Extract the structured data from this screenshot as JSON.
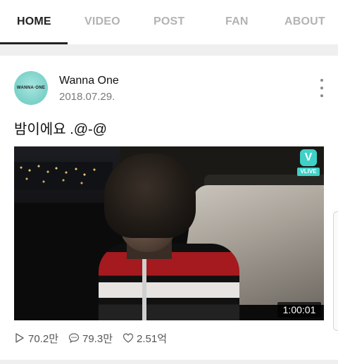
{
  "tabs": [
    {
      "label": "HOME",
      "active": true
    },
    {
      "label": "VIDEO",
      "active": false
    },
    {
      "label": "POST",
      "active": false
    },
    {
      "label": "FAN",
      "active": false
    },
    {
      "label": "ABOUT",
      "active": false
    }
  ],
  "post": {
    "avatar_text": "WANNA·ONE",
    "author": "Wanna One",
    "date": "2018.07.29.",
    "text": "밤이에요 .@-@",
    "video": {
      "badge_icon": "V",
      "badge_label": "VLIVE",
      "duration": "1:00:01"
    },
    "stats": {
      "plays": "70.2만",
      "comments": "79.3만",
      "likes": "2.51억"
    }
  },
  "colors": {
    "active_tab": "#222222",
    "inactive_tab": "#b3b3b3",
    "vlive_accent": "#3fd1c7",
    "band_gray": "#efefef"
  },
  "icons": {
    "more": "vertical-dots-icon",
    "plays": "play-icon",
    "comments": "comment-icon",
    "likes": "heart-icon"
  }
}
